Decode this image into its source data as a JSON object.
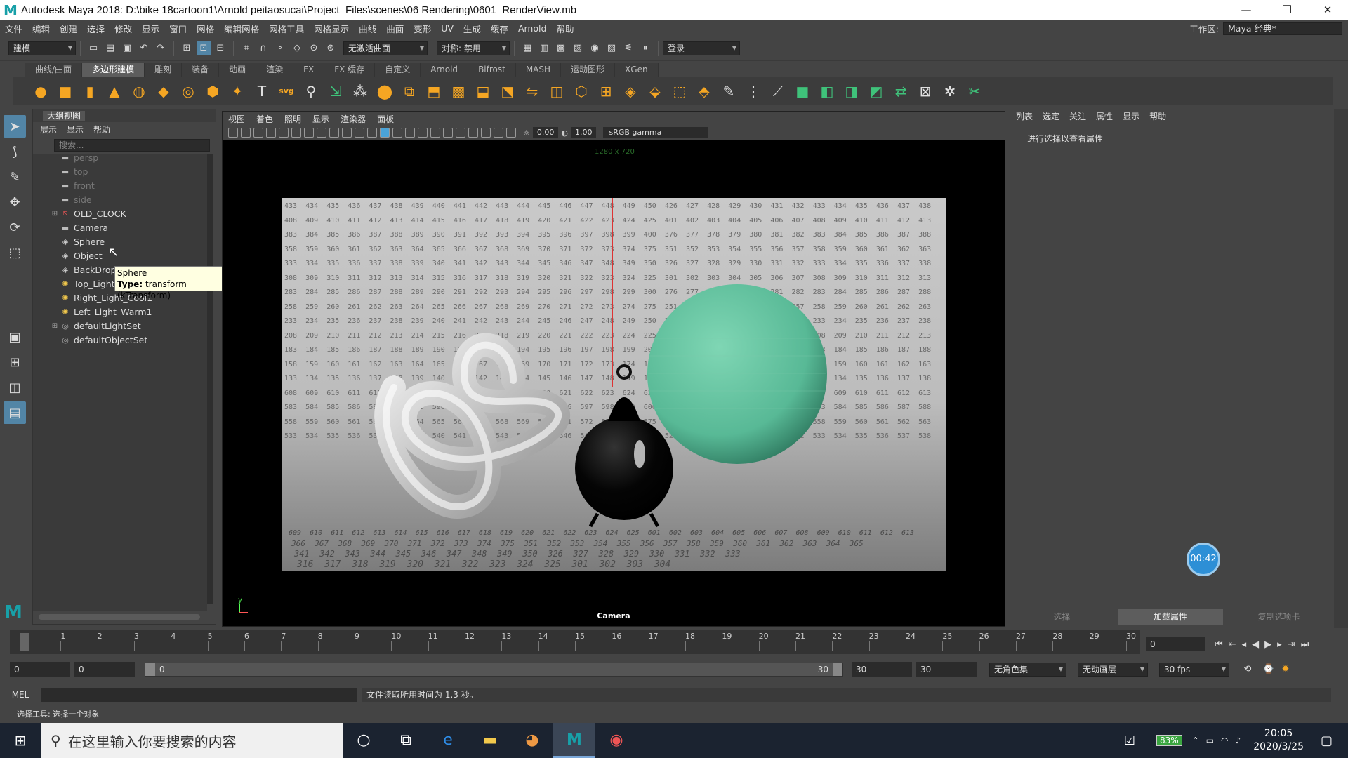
{
  "titlebar": {
    "logo": "M",
    "title": "Autodesk Maya 2018: D:\\bike 18cartoon1\\Arnold peitaosucai\\Project_Files\\scenes\\06 Rendering\\0601_RenderView.mb",
    "minimize": "—",
    "restore": "❐",
    "close": "✕"
  },
  "menubar": {
    "items": [
      "文件",
      "编辑",
      "创建",
      "选择",
      "修改",
      "显示",
      "窗口",
      "网格",
      "编辑网格",
      "网格工具",
      "网格显示",
      "曲线",
      "曲面",
      "变形",
      "UV",
      "生成",
      "缓存",
      "Arnold",
      "帮助"
    ],
    "workspace_label": "工作区:",
    "workspace_value": "Maya 经典*"
  },
  "statusline": {
    "mode": "建模",
    "live_surface": "无激活曲面",
    "symmetry": "对称: 禁用",
    "login": "登录"
  },
  "shelf": {
    "tabs": [
      "曲线/曲面",
      "多边形建模",
      "雕刻",
      "装备",
      "动画",
      "渲染",
      "FX",
      "FX 缓存",
      "自定义",
      "Arnold",
      "Bifrost",
      "MASH",
      "运动图形",
      "XGen"
    ],
    "active_tab": "多边形建模",
    "text_tool": "T",
    "svg_tool": "svg"
  },
  "outliner": {
    "title": "大纲视图",
    "menu": [
      "展示",
      "显示",
      "帮助"
    ],
    "search_placeholder": "搜索...",
    "items": [
      {
        "label": "persp",
        "dim": true,
        "icon": "camera",
        "expandable": false
      },
      {
        "label": "top",
        "dim": true,
        "icon": "camera",
        "expandable": false
      },
      {
        "label": "front",
        "dim": true,
        "icon": "camera",
        "expandable": false
      },
      {
        "label": "side",
        "dim": true,
        "icon": "camera",
        "expandable": false
      },
      {
        "label": "OLD_CLOCK",
        "dim": false,
        "icon": "group",
        "expandable": true
      },
      {
        "label": "Camera",
        "dim": false,
        "icon": "camera",
        "expandable": false
      },
      {
        "label": "Sphere",
        "dim": false,
        "icon": "transform",
        "expandable": false
      },
      {
        "label": "Object",
        "dim": false,
        "icon": "transform",
        "expandable": false
      },
      {
        "label": "BackDrop",
        "dim": false,
        "icon": "transform",
        "expandable": false
      },
      {
        "label": "Top_Light_White1",
        "dim": false,
        "icon": "light",
        "expandable": false
      },
      {
        "label": "Right_Light_Cool1",
        "dim": false,
        "icon": "light",
        "expandable": false
      },
      {
        "label": "Left_Light_Warm1",
        "dim": false,
        "icon": "light",
        "expandable": false
      },
      {
        "label": "defaultLightSet",
        "dim": false,
        "icon": "set",
        "expandable": true
      },
      {
        "label": "defaultObjectSet",
        "dim": false,
        "icon": "set",
        "expandable": false
      }
    ]
  },
  "tooltip": {
    "name": "Sphere",
    "type_label": "Type:",
    "type_value": "transform (kTransform)"
  },
  "viewport": {
    "menu": [
      "视图",
      "着色",
      "照明",
      "显示",
      "渲染器",
      "面板"
    ],
    "exposure": "0.00",
    "gamma_value": "1.00",
    "color_space": "sRGB gamma",
    "resolution": "1280 x 720",
    "camera_label": "Camera",
    "grid_rows": [
      "433  434  435  436  437  438  439  440  441  442  443  444  445  446  447  448  449  450  426  427  428  429  430  431  432  433  434  435  436  437  438",
      "408  409  410  411  412  413  414  415  416  417  418  419  420  421  422  423  424  425  401  402  403  404  405  406  407  408  409  410  411  412  413",
      "383  384  385  386  387  388  389  390  391  392  393  394  395  396  397  398  399  400  376  377  378  379  380  381  382  383  384  385  386  387  388",
      "358  359  360  361  362  363  364  365  366  367  368  369  370  371  372  373  374  375  351  352  353  354  355  356  357  358  359  360  361  362  363",
      "333  334  335  336  337  338  339  340  341  342  343  344  345  346  347  348  349  350  326  327  328  329  330  331  332  333  334  335  336  337  338",
      "308  309  310  311  312  313  314  315  316  317  318  319  320  321  322  323  324  325  301  302  303  304  305  306  307  308  309  310  311  312  313",
      "283  284  285  286  287  288  289  290  291  292  293  294  295  296  297  298  299  300  276  277  278  279  280  281  282  283  284  285  286  287  288",
      "258  259  260  261  262  263  264  265  266  267  268  269  270  271  272  273  274  275  251  252  253  254  255  256  257  258  259  260  261  262  263",
      "233  234  235  236  237  238  239  240  241  242  243  244  245  246  247  248  249  250  226  227  228  229  230  231  232  233  234  235  236  237  238",
      "208  209  210  211  212  213  214  215  216  217  218  219  220  221  222  223  224  225  201  202  203  204  205  206  207  208  209  210  211  212  213",
      "183  184  185  186  187  188  189  190  191  192  193  194  195  196  197  198  199  200  176  177  178  179  180  181  182  183  184  185  186  187  188",
      "158  159  160  161  162  163  164  165  166  167  168  169  170  171  172  173  174  175  151  152  153  154  155  156  157  158  159  160  161  162  163",
      "133  134  135  136  137  138  139  140  141  142  143  144  145  146  147  148  149  150  126  127  128  129  130  131  132  133  134  135  136  137  138",
      "608  609  610  611  612  613  614  615  616  617  618  619  620  621  622  623  624  625  601  602  603  604  605  606  607  608  609  610  611  612  613",
      "583  584  585  586  587  588  589  590  591  592  593  594  595  596  597  598  599  600  576  577  578  579  580  581  582  583  584  585  586  587  588",
      "558  559  560  561  562  563  564  565  566  567  568  569  570  571  572  573  574  575  551  552  553  554  555  556  557  558  559  560  561  562  563",
      "533  534  535  536  537  538  539  540  541  542  543  544  545  546  547  548  549  550  526  527  528  529  530  531  532  533  534  535  536  537  538"
    ],
    "floor_rows": [
      "609  610  611  612  613  614  615  616  617  618  619  620  621  622  623  624  625  601  602  603  604  605  606  607  608  609  610  611  612  613",
      "366  367  368  369  370  371  372  373  374  375  351  352  353  354  355  356  357  358  359  360  361  362  363  364  365",
      "341  342  343  344  345  346  347  348  349  350  326  327  328  329  330  331  332  333",
      "316  317  318  319  320  321  322  323  324  325  301  302  303  304"
    ]
  },
  "attribute_editor": {
    "menu": [
      "列表",
      "选定",
      "关注",
      "属性",
      "显示",
      "帮助"
    ],
    "hint": "进行选择以查看属性",
    "buttons": [
      "选择",
      "加载属性",
      "复制选项卡"
    ],
    "active_button": "加载属性",
    "timer": "00:42"
  },
  "timeslider": {
    "ticks": [
      "0",
      "1",
      "2",
      "3",
      "4",
      "5",
      "6",
      "7",
      "8",
      "9",
      "10",
      "11",
      "12",
      "13",
      "14",
      "15",
      "16",
      "17",
      "18",
      "19",
      "20",
      "21",
      "22",
      "23",
      "24",
      "25",
      "26",
      "27",
      "28",
      "29",
      "30"
    ],
    "current_frame": "0"
  },
  "range": {
    "start": "0",
    "anim_start": "0",
    "range_start": "0",
    "range_end": "30",
    "end": "30",
    "anim_end": "30",
    "character_set": "无角色集",
    "anim_layer": "无动画层",
    "fps": "30 fps"
  },
  "cmdline": {
    "label": "MEL",
    "result": "文件读取所用时间为 1.3 秒。"
  },
  "helpline": "选择工具: 选择一个对象",
  "taskbar": {
    "search_placeholder": "在这里输入你要搜索的内容",
    "battery": "83%",
    "time": "20:05",
    "date": "2020/3/25"
  }
}
